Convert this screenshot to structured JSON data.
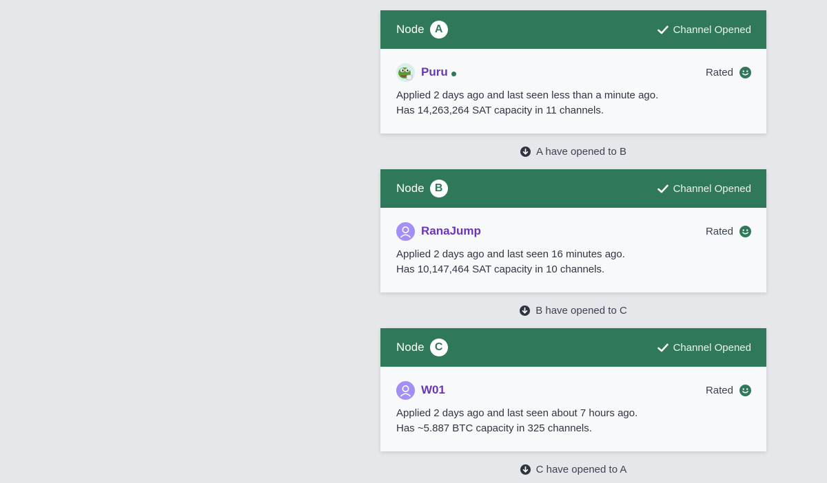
{
  "nodes": [
    {
      "label": "Node",
      "letter": "A",
      "status": "Channel Opened",
      "username": "Puru",
      "avatar": "pepe-avatar",
      "online": true,
      "rating": "Rated",
      "applied_line": "Applied 2 days ago and last seen less than a minute ago.",
      "capacity_line": "Has 14,263,264 SAT capacity in 11 channels.",
      "connector": "A have opened to B"
    },
    {
      "label": "Node",
      "letter": "B",
      "status": "Channel Opened",
      "username": "RanaJump",
      "avatar": "default-user-avatar",
      "online": false,
      "rating": "Rated",
      "applied_line": "Applied 2 days ago and last seen 16 minutes ago.",
      "capacity_line": "Has 10,147,464 SAT capacity in 10 channels.",
      "connector": "B have opened to C"
    },
    {
      "label": "Node",
      "letter": "C",
      "status": "Channel Opened",
      "username": "W01",
      "avatar": "default-user-avatar",
      "online": false,
      "rating": "Rated",
      "applied_line": "Applied 2 days ago and last seen about 7 hours ago.",
      "capacity_line": "Has ~5.887 BTC capacity in 325 channels.",
      "connector": "C have opened to A"
    }
  ],
  "colors": {
    "header_green": "#2f7859",
    "username_purple": "#6a36b8",
    "avatar_purple": "#a48ff5",
    "page_bg": "#e6e7ea"
  },
  "icons": {
    "status": "check-icon",
    "rating": "smile-icon",
    "connector": "arrow-down-circle-icon"
  }
}
